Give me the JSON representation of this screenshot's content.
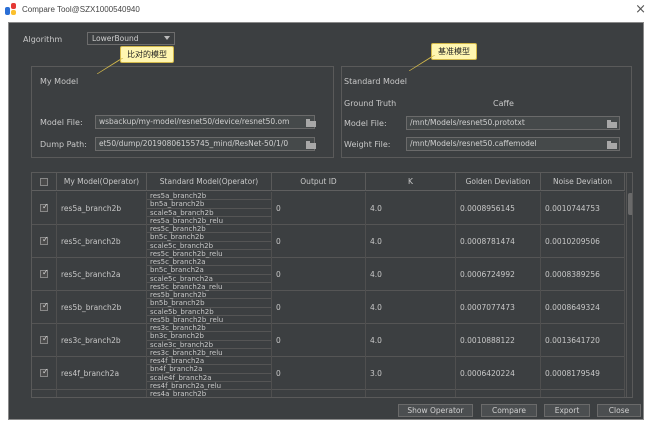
{
  "window": {
    "title": "Compare Tool@SZX1000540940"
  },
  "algorithm": {
    "label": "Algorithm",
    "value": "LowerBound"
  },
  "callouts": {
    "my_model": "比对的模型",
    "standard_model": "基准模型"
  },
  "my_model": {
    "section_title": "My Model",
    "model_file_label": "Model File:",
    "model_file_value": "wsbackup/my-model/resnet50/device/resnet50.om",
    "dump_path_label": "Dump Path:",
    "dump_path_value": "et50/dump/20190806155745_mind/ResNet-50/1/0"
  },
  "standard_model": {
    "section_title": "Standard Model",
    "ground_truth_label": "Ground Truth",
    "ground_truth_value": "Caffe",
    "model_file_label": "Model File:",
    "model_file_value": "/mnt/Models/resnet50.prototxt",
    "weight_file_label": "Weight File:",
    "weight_file_value": "/mnt/Models/resnet50.caffemodel"
  },
  "table": {
    "columns": [
      "My Model(Operator)",
      "Standard Model(Operator)",
      "Output ID",
      "K",
      "Golden Deviation",
      "Noise Deviation"
    ],
    "rows": [
      {
        "checked": true,
        "my_model": "res5a_branch2b",
        "standard": [
          "res5a_branch2b",
          "bn5a_branch2b",
          "scale5a_branch2b",
          "res5a_branch2b_relu"
        ],
        "output_id": "0",
        "k": "4.0",
        "golden": "0.0008956145",
        "noise": "0.0010744753"
      },
      {
        "checked": true,
        "my_model": "res5c_branch2b",
        "standard": [
          "res5c_branch2b",
          "bn5c_branch2b",
          "scale5c_branch2b",
          "res5c_branch2b_relu"
        ],
        "output_id": "0",
        "k": "4.0",
        "golden": "0.0008781474",
        "noise": "0.0010209506"
      },
      {
        "checked": true,
        "my_model": "res5c_branch2a",
        "standard": [
          "res5c_branch2a",
          "bn5c_branch2a",
          "scale5c_branch2a",
          "res5c_branch2a_relu"
        ],
        "output_id": "0",
        "k": "4.0",
        "golden": "0.0006724992",
        "noise": "0.0008389256"
      },
      {
        "checked": true,
        "my_model": "res5b_branch2b",
        "standard": [
          "res5b_branch2b",
          "bn5b_branch2b",
          "scale5b_branch2b",
          "res5b_branch2b_relu"
        ],
        "output_id": "0",
        "k": "4.0",
        "golden": "0.0007077473",
        "noise": "0.0008649324"
      },
      {
        "checked": true,
        "my_model": "res3c_branch2b",
        "standard": [
          "res3c_branch2b",
          "bn3c_branch2b",
          "scale3c_branch2b",
          "res3c_branch2b_relu"
        ],
        "output_id": "0",
        "k": "4.0",
        "golden": "0.0010888122",
        "noise": "0.0013641720"
      },
      {
        "checked": true,
        "my_model": "res4f_branch2a",
        "standard": [
          "res4f_branch2a",
          "bn4f_branch2a",
          "scale4f_branch2a",
          "res4f_branch2a_relu"
        ],
        "output_id": "0",
        "k": "3.0",
        "golden": "0.0006420224",
        "noise": "0.0008179549"
      },
      {
        "checked": false,
        "my_model": "",
        "standard": [
          "res4a_branch2b"
        ],
        "output_id": "",
        "k": "",
        "golden": "",
        "noise": ""
      }
    ]
  },
  "buttons": {
    "show_operator": "Show Operator",
    "compare": "Compare",
    "export": "Export",
    "close": "Close"
  }
}
